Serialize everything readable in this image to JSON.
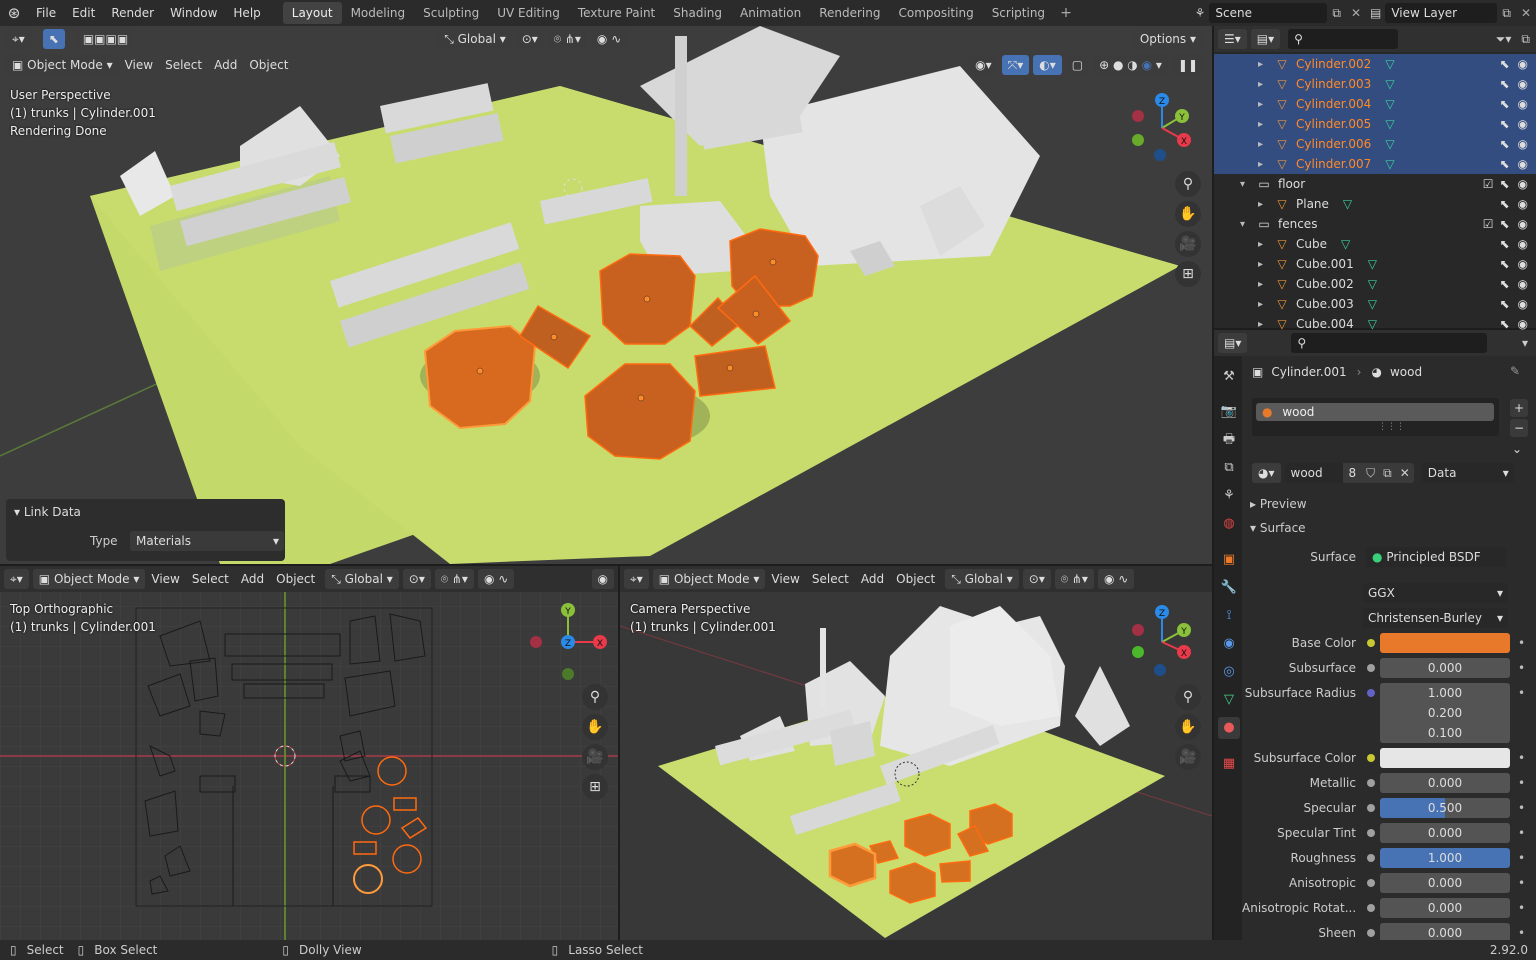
{
  "topbar": {
    "menus": [
      "File",
      "Edit",
      "Render",
      "Window",
      "Help"
    ],
    "workspaces": [
      "Layout",
      "Modeling",
      "Sculpting",
      "UV Editing",
      "Texture Paint",
      "Shading",
      "Animation",
      "Rendering",
      "Compositing",
      "Scripting"
    ],
    "active_workspace": "Layout",
    "scene": "Scene",
    "view_layer": "View Layer"
  },
  "viewport_main": {
    "mode": "Object Mode",
    "menus": [
      "View",
      "Select",
      "Add",
      "Object"
    ],
    "orientation": "Global",
    "options": "Options",
    "overlay": [
      "User Perspective",
      "(1) trunks | Cylinder.001",
      "Rendering Done"
    ],
    "link_panel": {
      "title": "Link Data",
      "type_label": "Type",
      "type_value": "Materials"
    }
  },
  "viewport_top": {
    "mode": "Object Mode",
    "menus": [
      "View",
      "Select",
      "Add",
      "Object"
    ],
    "orientation": "Global",
    "overlay": [
      "Top Orthographic",
      "(1) trunks | Cylinder.001"
    ]
  },
  "viewport_cam": {
    "mode": "Object Mode",
    "menus": [
      "View",
      "Select",
      "Add",
      "Object"
    ],
    "orientation": "Global",
    "overlay": [
      "Camera Perspective",
      "(1) trunks | Cylinder.001"
    ]
  },
  "gizmo_axes": {
    "x": "X",
    "y": "Y",
    "z": "Z"
  },
  "outliner": {
    "rows": [
      {
        "name": "Cylinder.002",
        "indent": 2,
        "selected": true,
        "orange": true
      },
      {
        "name": "Cylinder.003",
        "indent": 2,
        "selected": true,
        "orange": true
      },
      {
        "name": "Cylinder.004",
        "indent": 2,
        "selected": true,
        "orange": true
      },
      {
        "name": "Cylinder.005",
        "indent": 2,
        "selected": true,
        "orange": true
      },
      {
        "name": "Cylinder.006",
        "indent": 2,
        "selected": true,
        "orange": true
      },
      {
        "name": "Cylinder.007",
        "indent": 2,
        "selected": true,
        "orange": true
      },
      {
        "name": "floor",
        "indent": 1,
        "collection": true
      },
      {
        "name": "Plane",
        "indent": 2
      },
      {
        "name": "fences",
        "indent": 1,
        "collection": true
      },
      {
        "name": "Cube",
        "indent": 2
      },
      {
        "name": "Cube.001",
        "indent": 2
      },
      {
        "name": "Cube.002",
        "indent": 2
      },
      {
        "name": "Cube.003",
        "indent": 2
      },
      {
        "name": "Cube.004",
        "indent": 2
      }
    ]
  },
  "properties": {
    "object": "Cylinder.001",
    "material": "wood",
    "slot": "wood",
    "users": "8",
    "link": "Data",
    "preview": "Preview",
    "surface_panel": "Surface",
    "surface_label": "Surface",
    "surface_value": "Principled BSDF",
    "distribution": "GGX",
    "subsurface_method": "Christensen-Burley",
    "rows": [
      {
        "label": "Base Color",
        "kind": "color",
        "color": "#e8782a",
        "dot": "#c8c832"
      },
      {
        "label": "Subsurface",
        "value": "0.000",
        "dot": "#a0a0a0"
      },
      {
        "label": "Subsurface Radius",
        "values": [
          "1.000",
          "0.200",
          "0.100"
        ],
        "dot": "#6363c7"
      },
      {
        "label": "Subsurface Color",
        "kind": "color",
        "color": "#e6e6e6",
        "dot": "#c8c832"
      },
      {
        "label": "Metallic",
        "value": "0.000",
        "dot": "#a0a0a0"
      },
      {
        "label": "Specular",
        "value": "0.500",
        "fill": 0.5,
        "dot": "#a0a0a0"
      },
      {
        "label": "Specular Tint",
        "value": "0.000",
        "dot": "#a0a0a0"
      },
      {
        "label": "Roughness",
        "value": "1.000",
        "fill": 1.0,
        "dot": "#a0a0a0"
      },
      {
        "label": "Anisotropic",
        "value": "0.000",
        "dot": "#a0a0a0"
      },
      {
        "label": "Anisotropic Rotat...",
        "value": "0.000",
        "dot": "#a0a0a0"
      },
      {
        "label": "Sheen",
        "value": "0.000",
        "dot": "#a0a0a0"
      }
    ]
  },
  "statusbar": {
    "select": "Select",
    "box_select": "Box Select",
    "dolly": "Dolly View",
    "lasso": "Lasso Select",
    "version": "2.92.0"
  },
  "colors": {
    "selected_row": "#334d80",
    "orange": "#ff8a28",
    "accent_blue": "#4772b3"
  }
}
